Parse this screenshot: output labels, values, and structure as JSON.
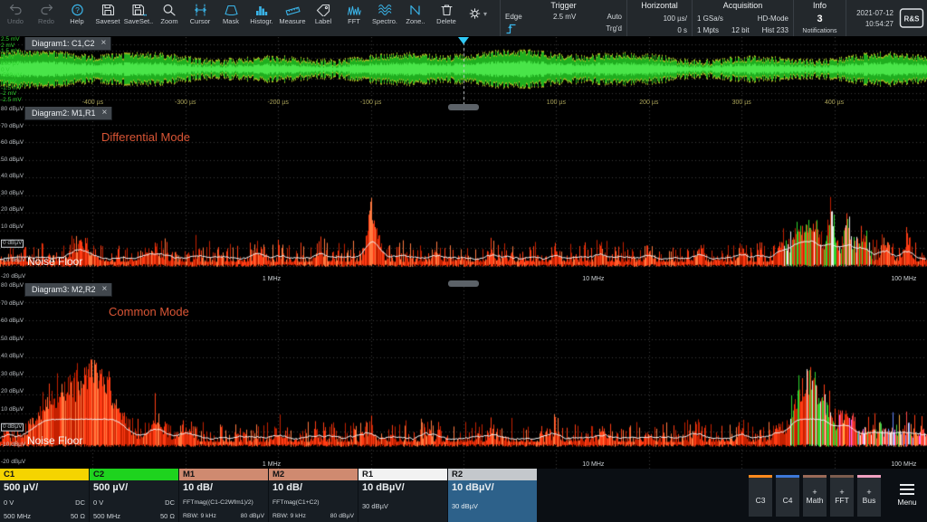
{
  "toolbar": {
    "buttons": [
      "Undo",
      "Redo",
      "Help",
      "Saveset",
      "SaveSet..",
      "Zoom",
      "Cursor",
      "Mask",
      "Histogr.",
      "Measure",
      "Label",
      "FFT",
      "Spectro.",
      "Zone..",
      "Delete"
    ]
  },
  "trigger": {
    "title": "Trigger",
    "type": "Edge",
    "level": "2.5 mV",
    "mode": "Auto",
    "state": "Trg'd"
  },
  "horizontal": {
    "title": "Horizontal",
    "scale": "100 µs/",
    "position": "0 s"
  },
  "acquisition": {
    "title": "Acquisition",
    "sample_rate": "1 GSa/s",
    "mode": "HD-Mode",
    "record_length": "1 Mpts",
    "resolution": "12 bit",
    "history": "Hist 233"
  },
  "info": {
    "title": "Info",
    "count": "3",
    "label": "Notifications"
  },
  "clock": {
    "date": "2021-07-12",
    "time": "10:54:27"
  },
  "diagram1": {
    "tab": "Diagram1: C1,C2",
    "close": "×",
    "y_labels": [
      "2.5 mV",
      "2 mV",
      "1.5 mV",
      "1 mV",
      "500 µV",
      "0 V",
      "-500 µV",
      "-1 mV",
      "-1.5 mV",
      "-2 mV",
      "-2.5 mV"
    ],
    "x_labels": [
      "-400 µs",
      "-300 µs",
      "-200 µs",
      "-100 µs",
      "100 µs",
      "200 µs",
      "300 µs",
      "400 µs"
    ],
    "x_fracs": [
      0.1,
      0.2,
      0.3,
      0.4,
      0.6,
      0.7,
      0.8,
      0.9
    ],
    "trace": {
      "seed": 9
    }
  },
  "diagram2": {
    "tab": "Diagram2: M1,R1",
    "close": "×",
    "annotation": "Differential Mode",
    "noise_floor": "Noise Floor",
    "y_labels": [
      "80 dBµV",
      "70 dBµV",
      "60 dBµV",
      "50 dBµV",
      "40 dBµV",
      "30 dBµV",
      "20 dBµV",
      "10 dBµV",
      "0 dBµV",
      "-10 dBµV",
      "-20 dBµV"
    ],
    "boxed_index": 8,
    "x_labels": [
      "1 MHz",
      "10 MHz",
      "100 MHz"
    ],
    "x_fracs": [
      0.293,
      0.64,
      0.975
    ],
    "trace": {
      "seed": 11,
      "base": 0.885,
      "noise": 0.1,
      "peaks": [
        {
          "x": 0.088,
          "h": 0.075,
          "w": 0.01
        },
        {
          "x": 0.163,
          "h": 0.05,
          "w": 0.008
        },
        {
          "x": 0.28,
          "h": 0.04,
          "w": 0.004
        },
        {
          "x": 0.345,
          "h": 0.05,
          "w": 0.004
        },
        {
          "x": 0.4,
          "h": 0.3,
          "w": 0.0035
        },
        {
          "x": 0.408,
          "h": 0.12,
          "w": 0.003
        },
        {
          "x": 0.47,
          "h": 0.05,
          "w": 0.003
        },
        {
          "x": 0.53,
          "h": 0.045,
          "w": 0.003
        },
        {
          "x": 0.6,
          "h": 0.05,
          "w": 0.003
        },
        {
          "x": 0.648,
          "h": 0.06,
          "w": 0.003
        },
        {
          "x": 0.7,
          "h": 0.05,
          "w": 0.003
        },
        {
          "x": 0.754,
          "h": 0.06,
          "w": 0.003
        },
        {
          "x": 0.8,
          "h": 0.07,
          "w": 0.003
        },
        {
          "x": 0.842,
          "h": 0.1,
          "w": 0.004
        },
        {
          "x": 0.862,
          "h": 0.16,
          "w": 0.008
        },
        {
          "x": 0.878,
          "h": 0.18,
          "w": 0.006
        },
        {
          "x": 0.896,
          "h": 0.29,
          "w": 0.0035
        },
        {
          "x": 0.913,
          "h": 0.22,
          "w": 0.004
        },
        {
          "x": 0.93,
          "h": 0.12,
          "w": 0.005
        },
        {
          "x": 0.955,
          "h": 0.09,
          "w": 0.004
        },
        {
          "x": 0.978,
          "h": 0.08,
          "w": 0.004
        }
      ],
      "cluster": {
        "from": 0.845,
        "to": 0.94
      }
    }
  },
  "diagram3": {
    "tab": "Diagram3: M2,R2",
    "close": "×",
    "annotation": "Common Mode",
    "noise_floor": "Noise Floor",
    "y_labels": [
      "80 dBµV",
      "70 dBµV",
      "60 dBµV",
      "50 dBµV",
      "40 dBµV",
      "30 dBµV",
      "20 dBµV",
      "10 dBµV",
      "0 dBµV",
      "-10 dBµV",
      "-20 dBµV"
    ],
    "boxed_index": 8,
    "x_labels": [
      "1 MHz",
      "10 MHz",
      "100 MHz"
    ],
    "x_fracs": [
      0.293,
      0.64,
      0.975
    ],
    "trace": {
      "seed": 23,
      "base": 0.862,
      "noise": 0.1,
      "peaks": [
        {
          "x": 0.048,
          "h": 0.1,
          "w": 0.012
        },
        {
          "x": 0.083,
          "h": 0.28,
          "w": 0.022
        },
        {
          "x": 0.105,
          "h": 0.18,
          "w": 0.012
        },
        {
          "x": 0.128,
          "h": 0.1,
          "w": 0.01
        },
        {
          "x": 0.168,
          "h": 0.09,
          "w": 0.008
        },
        {
          "x": 0.2,
          "h": 0.06,
          "w": 0.006
        },
        {
          "x": 0.3,
          "h": 0.04,
          "w": 0.004
        },
        {
          "x": 0.4,
          "h": 0.055,
          "w": 0.0035
        },
        {
          "x": 0.46,
          "h": 0.04,
          "w": 0.003
        },
        {
          "x": 0.53,
          "h": 0.04,
          "w": 0.003
        },
        {
          "x": 0.6,
          "h": 0.045,
          "w": 0.003
        },
        {
          "x": 0.65,
          "h": 0.05,
          "w": 0.003
        },
        {
          "x": 0.7,
          "h": 0.045,
          "w": 0.003
        },
        {
          "x": 0.75,
          "h": 0.05,
          "w": 0.003
        },
        {
          "x": 0.8,
          "h": 0.06,
          "w": 0.003
        },
        {
          "x": 0.84,
          "h": 0.08,
          "w": 0.004
        },
        {
          "x": 0.862,
          "h": 0.25,
          "w": 0.007
        },
        {
          "x": 0.876,
          "h": 0.3,
          "w": 0.005
        },
        {
          "x": 0.89,
          "h": 0.2,
          "w": 0.006
        },
        {
          "x": 0.91,
          "h": 0.1,
          "w": 0.006
        }
      ],
      "cluster": {
        "from": 0.848,
        "to": 0.925
      },
      "tail": {
        "from": 0.905,
        "lift": 0.06,
        "colors": [
          "#ff4444",
          "#ff66ff",
          "#ededed",
          "#44cc44",
          "#6688ff",
          "#ffaa44"
        ]
      }
    }
  },
  "signals": {
    "c1": {
      "name": "C1",
      "scale": "500 µV/",
      "offset": "0 V",
      "coupling": "DC",
      "bandwidth": "500 MHz",
      "impedance": "50 Ω",
      "color": "#f5d400"
    },
    "c2": {
      "name": "C2",
      "scale": "500 µV/",
      "offset": "0 V",
      "coupling": "DC",
      "bandwidth": "500 MHz",
      "impedance": "50 Ω",
      "color": "#1ed31e"
    },
    "m1": {
      "name": "M1",
      "scale": "10 dB/",
      "formula": "FFTmag((C1-C2Wfm1)/2)",
      "rbw": "RBW: 9 kHz",
      "ref": "80 dBµV",
      "color": "#cf8a70"
    },
    "m2": {
      "name": "M2",
      "scale": "10 dB/",
      "formula": "FFTmag(C1+C2)",
      "rbw": "RBW: 9 kHz",
      "ref": "80 dBµV",
      "color": "#cf8a70"
    },
    "r1": {
      "name": "R1",
      "scale": "10 dBµV/",
      "level": "30 dBµV",
      "color": "#f2f2f2"
    },
    "r2": {
      "name": "R2",
      "scale": "10 dBµV/",
      "level": "30 dBµV",
      "color": "#c4c8cc"
    }
  },
  "add_buttons": [
    {
      "label": "C3",
      "plus": "",
      "color": "#ff8a1e"
    },
    {
      "label": "C4",
      "plus": "",
      "color": "#3d78d8"
    },
    {
      "label": "Math",
      "plus": "+",
      "color": "#9a6a58"
    },
    {
      "label": "FFT",
      "plus": "+",
      "color": "#7c5c4e"
    },
    {
      "label": "Bus",
      "plus": "+",
      "color": "#f0a0c0"
    }
  ],
  "menu_label": "Menu"
}
